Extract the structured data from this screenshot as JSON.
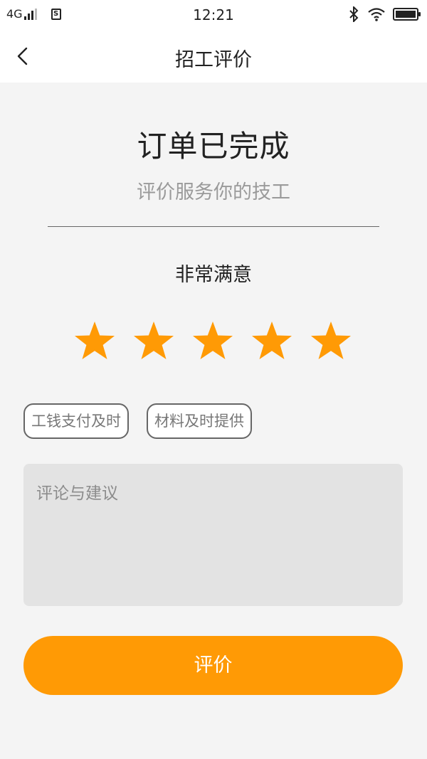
{
  "status_bar": {
    "network": "4G",
    "time": "12:21"
  },
  "nav": {
    "title": "招工评价"
  },
  "order": {
    "title": "订单已完成",
    "subtitle": "评价服务你的技工"
  },
  "rating": {
    "label": "非常满意",
    "stars_filled": 5,
    "stars_total": 5,
    "star_color": "#ff9a05"
  },
  "tags": [
    {
      "label": "工钱支付及时"
    },
    {
      "label": "材料及时提供"
    }
  ],
  "comment": {
    "placeholder": "评论与建议",
    "value": ""
  },
  "submit": {
    "label": "评价",
    "color": "#ff9a05"
  },
  "icons": {
    "back": "chevron-left-icon",
    "star": "star-icon",
    "bluetooth": "bluetooth-icon",
    "wifi": "wifi-icon",
    "battery": "battery-icon",
    "sim": "sim-icon"
  }
}
